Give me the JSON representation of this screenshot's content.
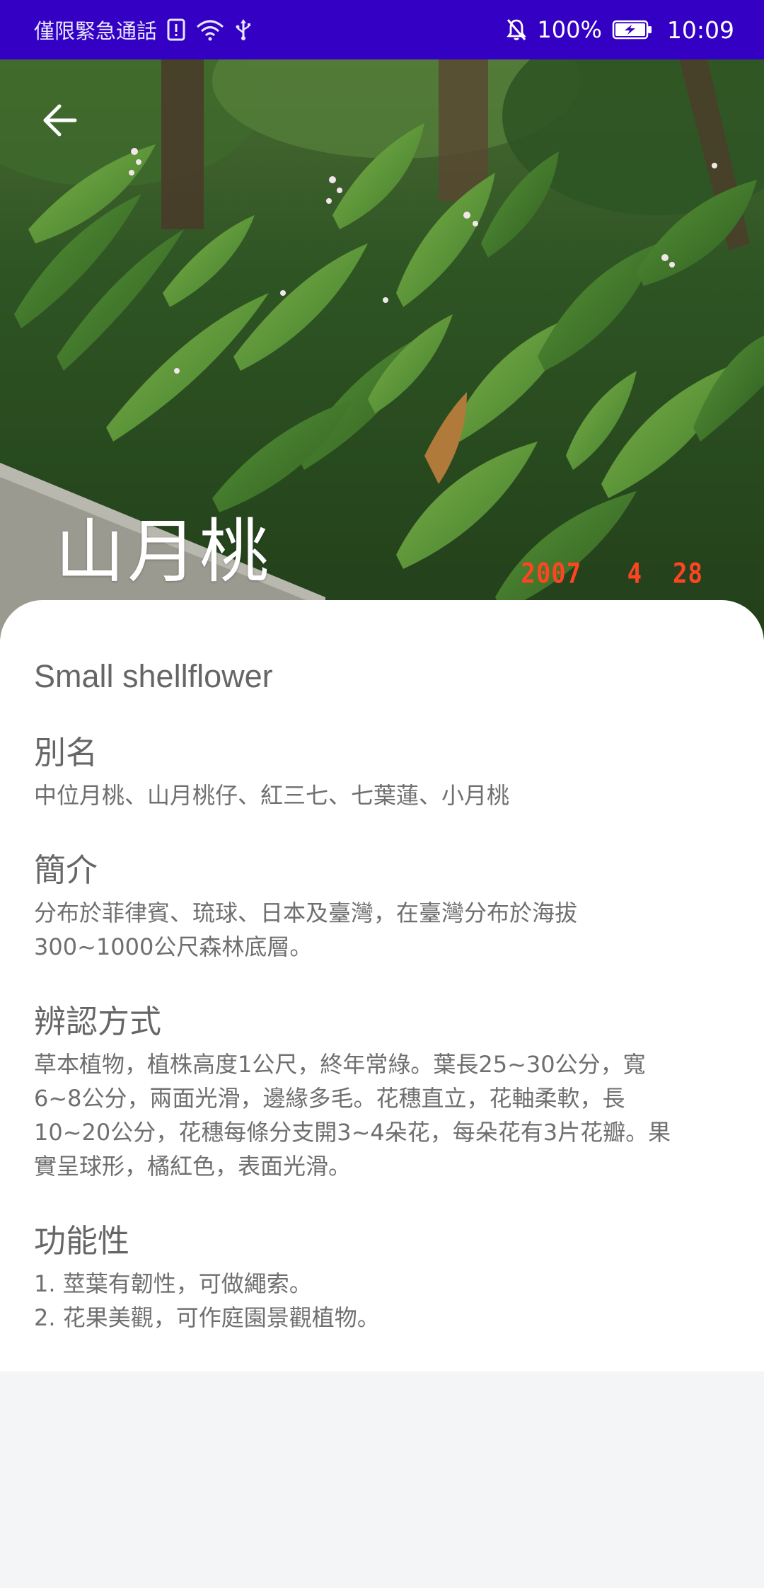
{
  "status_bar": {
    "carrier_text": "僅限緊急通話",
    "battery_percent": "100%",
    "time": "10:09",
    "icons": [
      "alert-card-icon",
      "wifi-icon",
      "usb-icon",
      "bell-off-icon",
      "battery-charging-icon"
    ]
  },
  "header": {
    "back_icon": "arrow-left-icon",
    "title": "山月桃",
    "photo_date_stamp": "2007   4  28"
  },
  "content": {
    "english_name": "Small shellflower",
    "sections": [
      {
        "heading": "別名",
        "lines": [
          "中位月桃、山月桃仔、紅三七、七葉蓮、小月桃"
        ]
      },
      {
        "heading": "簡介",
        "lines": [
          "分布於菲律賓、琉球、日本及臺灣，在臺灣分布於海拔",
          "300~1000公尺森林底層。"
        ]
      },
      {
        "heading": "辨認方式",
        "lines": [
          "草本植物，植株高度1公尺，終年常綠。葉長25~30公分，寬",
          "6~8公分，兩面光滑，邊緣多毛。花穗直立，花軸柔軟，長",
          "10~20公分，花穗每條分支開3~4朵花，每朵花有3片花瓣。果",
          "實呈球形，橘紅色，表面光滑。"
        ]
      },
      {
        "heading": "功能性",
        "lines": [
          "1. 莖葉有韌性，可做繩索。",
          "2. 花果美觀，可作庭園景觀植物。"
        ]
      }
    ]
  },
  "colors": {
    "status_bar": "#3300c4",
    "card_background": "#ffffff",
    "page_background": "#f4f5f7",
    "text_gray": "#666666",
    "date_stamp": "#ff4422"
  }
}
